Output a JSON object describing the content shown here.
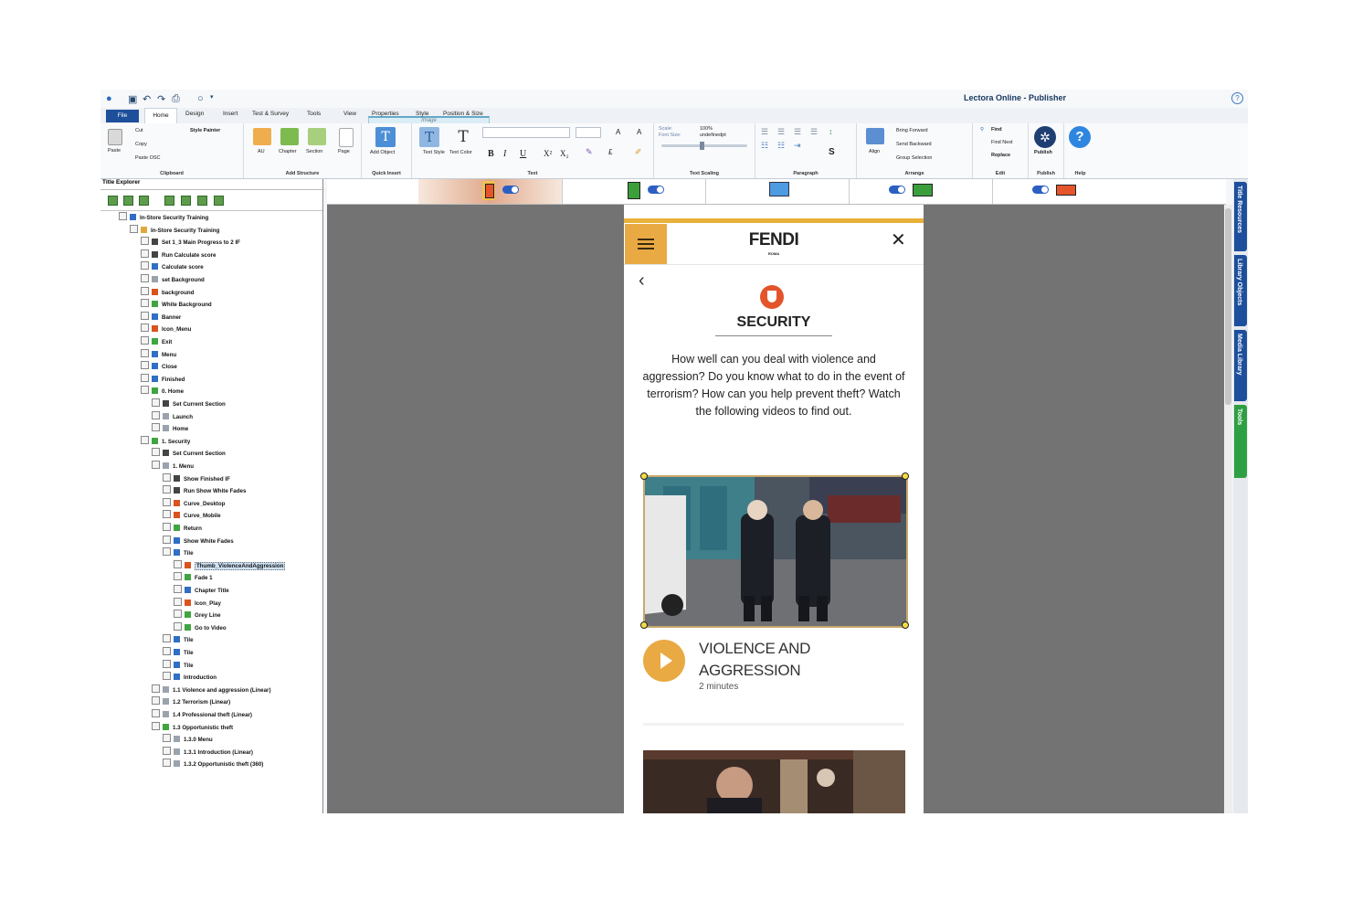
{
  "app_title": "Lectora Online - Publisher",
  "tabs": {
    "file": "File",
    "items": [
      "Home",
      "Design",
      "Insert",
      "Test & Survey",
      "Tools",
      "View",
      "Properties",
      "Style",
      "Position & Size"
    ],
    "context_label": "Image"
  },
  "ribbon": {
    "clipboard": {
      "cut": "Cut",
      "copy": "Copy",
      "paste": "Paste",
      "paste_osc": "Paste OSC",
      "style_painter": "Style Painter",
      "group": "Clipboard"
    },
    "add_structure": {
      "au": "AU",
      "chapter": "Chapter",
      "section": "Section",
      "page": "Page",
      "group": "Add Structure"
    },
    "quick_insert": {
      "add_object": "Add Object",
      "group": "Quick Insert"
    },
    "text": {
      "text_style": "Text Style",
      "text_color": "Text Color",
      "group": "Text",
      "bold": "B",
      "italic": "I",
      "underline": "U"
    },
    "text_scaling": {
      "scale_label": "Scale:",
      "scale_value": "100%",
      "font_size_label": "Font Size:",
      "font_size_value": "undefinedpt",
      "group": "Text Scaling"
    },
    "paragraph": {
      "group": "Paragraph"
    },
    "arrange": {
      "align": "Align",
      "bring_forward": "Bring Forward",
      "send_backward": "Send Backward",
      "group_selection": "Group Selection",
      "group": "Arrange"
    },
    "edit": {
      "find": "Find",
      "find_next": "Find Next",
      "replace": "Replace",
      "group": "Edit"
    },
    "publish": {
      "label": "Publish",
      "group": "Publish"
    },
    "help": {
      "group": "Help"
    }
  },
  "explorer": {
    "title": "Title Explorer",
    "nodes": [
      {
        "label": "In-Store Security Training",
        "depth": 0,
        "icon": "title-icon",
        "color": "#2f6fc4"
      },
      {
        "label": "In-Store Security Training",
        "depth": 1,
        "icon": "folder-icon",
        "color": "#e2a73a"
      },
      {
        "label": "Set 1_3 Main Progress to 2 IF",
        "depth": 2,
        "icon": "action-icon",
        "color": "#444444"
      },
      {
        "label": "Run Calculate score",
        "depth": 2,
        "icon": "action-icon",
        "color": "#444444"
      },
      {
        "label": "Calculate score",
        "depth": 2,
        "icon": "group-icon",
        "color": "#2f6fc4"
      },
      {
        "label": "set Background",
        "depth": 2,
        "icon": "page-icon",
        "color": "#9aa3ad"
      },
      {
        "label": "background",
        "depth": 2,
        "icon": "image-icon",
        "color": "#d9531e"
      },
      {
        "label": "White Background",
        "depth": 2,
        "icon": "shape-icon",
        "color": "#3fa541"
      },
      {
        "label": "Banner",
        "depth": 2,
        "icon": "group-icon",
        "color": "#2f6fc4"
      },
      {
        "label": "Icon_Menu",
        "depth": 2,
        "icon": "image-icon",
        "color": "#d9531e"
      },
      {
        "label": "Exit",
        "depth": 2,
        "icon": "button-icon",
        "color": "#3fa541"
      },
      {
        "label": "Menu",
        "depth": 2,
        "icon": "group-icon",
        "color": "#2f6fc4"
      },
      {
        "label": "Close",
        "depth": 2,
        "icon": "group-icon",
        "color": "#2f6fc4"
      },
      {
        "label": "Finished",
        "depth": 2,
        "icon": "group-icon",
        "color": "#2f6fc4"
      },
      {
        "label": "0. Home",
        "depth": 2,
        "icon": "chapter-icon",
        "color": "#3fa541"
      },
      {
        "label": "Set Current Section",
        "depth": 3,
        "icon": "action-icon",
        "color": "#444444"
      },
      {
        "label": "Launch",
        "depth": 3,
        "icon": "page-icon",
        "color": "#9aa3ad"
      },
      {
        "label": "Home",
        "depth": 3,
        "icon": "page-icon",
        "color": "#9aa3ad"
      },
      {
        "label": "1. Security",
        "depth": 2,
        "icon": "chapter-icon",
        "color": "#3fa541"
      },
      {
        "label": "Set Current Section",
        "depth": 3,
        "icon": "action-icon",
        "color": "#444444"
      },
      {
        "label": "1. Menu",
        "depth": 3,
        "icon": "page-icon",
        "color": "#9aa3ad"
      },
      {
        "label": "Show Finished IF",
        "depth": 4,
        "icon": "action-icon",
        "color": "#444444"
      },
      {
        "label": "Run Show White Fades",
        "depth": 4,
        "icon": "action-icon",
        "color": "#444444"
      },
      {
        "label": "Curve_Desktop",
        "depth": 4,
        "icon": "image-icon",
        "color": "#d9531e"
      },
      {
        "label": "Curve_Mobile",
        "depth": 4,
        "icon": "image-icon",
        "color": "#d9531e"
      },
      {
        "label": "Return",
        "depth": 4,
        "icon": "button-icon",
        "color": "#3fa541"
      },
      {
        "label": "Show White Fades",
        "depth": 4,
        "icon": "group-icon",
        "color": "#2f6fc4"
      },
      {
        "label": "Tile",
        "depth": 4,
        "icon": "group-icon",
        "color": "#2f6fc4"
      },
      {
        "label": "Thumb_ViolenceAndAggression",
        "depth": 5,
        "icon": "image-icon",
        "color": "#d9531e",
        "selected": true
      },
      {
        "label": "Fade 1",
        "depth": 5,
        "icon": "shape-icon",
        "color": "#3fa541"
      },
      {
        "label": "Chapter Title",
        "depth": 5,
        "icon": "text-icon",
        "color": "#2f6fc4"
      },
      {
        "label": "Icon_Play",
        "depth": 5,
        "icon": "image-icon",
        "color": "#d9531e"
      },
      {
        "label": "Grey Line",
        "depth": 5,
        "icon": "shape-icon",
        "color": "#3fa541"
      },
      {
        "label": "Go to Video",
        "depth": 5,
        "icon": "button-icon",
        "color": "#3fa541"
      },
      {
        "label": "Tile",
        "depth": 4,
        "icon": "group-icon",
        "color": "#2f6fc4"
      },
      {
        "label": "Tile",
        "depth": 4,
        "icon": "group-icon",
        "color": "#2f6fc4"
      },
      {
        "label": "Tile",
        "depth": 4,
        "icon": "group-icon",
        "color": "#2f6fc4"
      },
      {
        "label": "Introduction",
        "depth": 4,
        "icon": "group-icon",
        "color": "#2f6fc4"
      },
      {
        "label": "1.1 Violence and aggression (Linear)",
        "depth": 3,
        "icon": "page-icon",
        "color": "#9aa3ad"
      },
      {
        "label": "1.2 Terrorism (Linear)",
        "depth": 3,
        "icon": "page-icon",
        "color": "#9aa3ad"
      },
      {
        "label": "1.4 Professional theft (Linear)",
        "depth": 3,
        "icon": "page-icon",
        "color": "#9aa3ad"
      },
      {
        "label": "1.3 Opportunistic theft",
        "depth": 3,
        "icon": "chapter-icon",
        "color": "#3fa541"
      },
      {
        "label": "1.3.0 Menu",
        "depth": 4,
        "icon": "page-icon",
        "color": "#9aa3ad"
      },
      {
        "label": "1.3.1 Introduction (Linear)",
        "depth": 4,
        "icon": "page-icon",
        "color": "#9aa3ad"
      },
      {
        "label": "1.3.2 Opportunistic theft (360)",
        "depth": 4,
        "icon": "page-icon",
        "color": "#9aa3ad"
      }
    ]
  },
  "page": {
    "brand": "FENDI",
    "brand_sub": "ROMA",
    "section_title": "SECURITY",
    "intro": "How well can you deal with violence and aggression? Do you know what to do in the event of terrorism? How can you help prevent theft? Watch the following videos to find out.",
    "video_title": "VIOLENCE AND AGGRESSION",
    "duration": "2 minutes"
  },
  "side_tabs": [
    {
      "label": "Title Resources",
      "color": "#1d4f9c"
    },
    {
      "label": "Library Objects",
      "color": "#1d4f9c"
    },
    {
      "label": "Media Library",
      "color": "#1d4f9c"
    },
    {
      "label": "Tools",
      "color": "#2ea043"
    }
  ],
  "colors": {
    "accent": "#e9a943",
    "ribbon_blue": "#1e4f9a",
    "canvas": "#737373"
  }
}
